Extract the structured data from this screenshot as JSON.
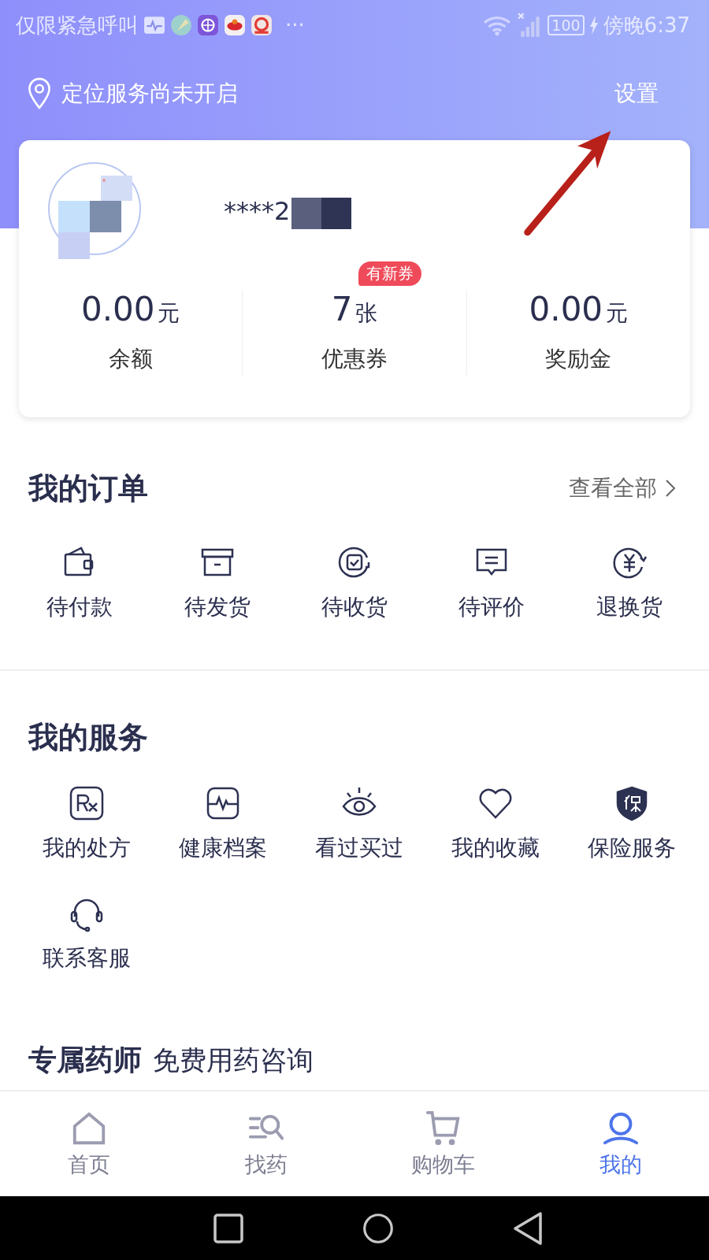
{
  "status_bar": {
    "carrier": "仅限紧急呼叫",
    "more": "···",
    "battery": "100",
    "time": "傍晚6:37"
  },
  "header": {
    "location": "定位服务尚未开启",
    "settings": "设置"
  },
  "profile": {
    "username": "****2",
    "stats": [
      {
        "value": "0.00",
        "unit": "元",
        "label": "余额"
      },
      {
        "value": "7",
        "unit": "张",
        "label": "优惠券",
        "badge": "有新券"
      },
      {
        "value": "0.00",
        "unit": "元",
        "label": "奖励金"
      }
    ]
  },
  "orders": {
    "title": "我的订单",
    "view_all": "查看全部",
    "items": [
      {
        "kind": "wallet",
        "label": "待付款"
      },
      {
        "kind": "box",
        "label": "待发货"
      },
      {
        "kind": "receive",
        "label": "待收货"
      },
      {
        "kind": "comment",
        "label": "待评价"
      },
      {
        "kind": "refund",
        "label": "退换货"
      }
    ]
  },
  "services": {
    "title": "我的服务",
    "items": [
      {
        "kind": "rx",
        "label": "我的处方"
      },
      {
        "kind": "health",
        "label": "健康档案"
      },
      {
        "kind": "eye",
        "label": "看过买过"
      },
      {
        "kind": "heart",
        "label": "我的收藏"
      },
      {
        "kind": "shield",
        "label": "保险服务"
      },
      {
        "kind": "headset",
        "label": "联系客服"
      }
    ]
  },
  "pharmacist": {
    "title": "专属药师",
    "subtitle": "免费用药咨询"
  },
  "bottom_nav": [
    {
      "kind": "home",
      "label": "首页",
      "selected": false
    },
    {
      "kind": "search",
      "label": "找药",
      "selected": false
    },
    {
      "kind": "cart",
      "label": "购物车",
      "selected": false
    },
    {
      "kind": "user",
      "label": "我的",
      "selected": true
    }
  ]
}
